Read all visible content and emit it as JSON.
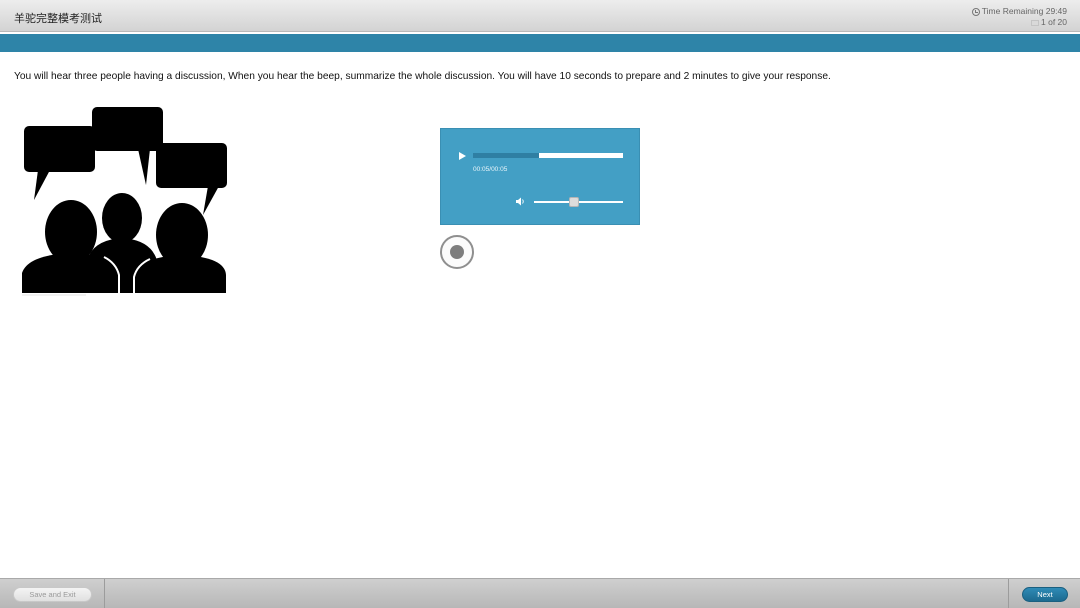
{
  "header": {
    "title": "羊驼完整模考测试",
    "timer_text": "Time Remaining 29:49",
    "progress_text": "1 of 20",
    "timer_icon": "clock-icon",
    "progress_icon": "page-icon"
  },
  "instructions": "You will hear three people having a discussion, When you hear the beep, summarize the whole discussion. You will have 10 seconds to prepare and 2 minutes to give your response.",
  "illustration": {
    "icon": "people-discussion-icon"
  },
  "audio_player": {
    "time_display": "00:05/00:05",
    "playback_progress": 0.44,
    "volume_level": 0.45,
    "play_icon": "play-icon",
    "volume_icon": "speaker-icon",
    "background_color": "#439fc5"
  },
  "record": {
    "icon": "record-icon"
  },
  "footer": {
    "save_exit_label": "Save and Exit",
    "next_label": "Next",
    "accent_color": "#2e84a8"
  }
}
